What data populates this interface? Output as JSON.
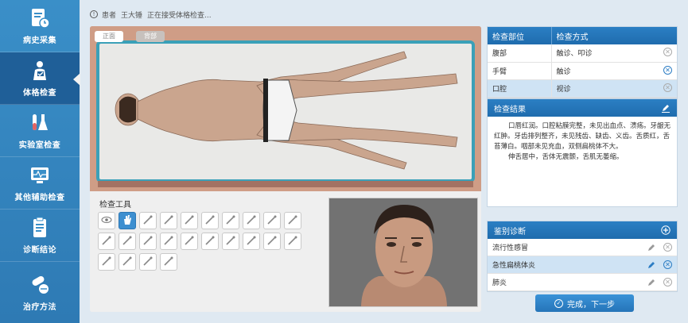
{
  "sidebar": {
    "items": [
      {
        "label": "病史采集",
        "icon": "clock-clipboard-icon"
      },
      {
        "label": "体格检查",
        "icon": "person-check-icon"
      },
      {
        "label": "实验室检查",
        "icon": "test-tube-icon"
      },
      {
        "label": "其他辅助检查",
        "icon": "monitor-icon"
      },
      {
        "label": "诊断结论",
        "icon": "clipboard-icon"
      },
      {
        "label": "治疗方法",
        "icon": "pills-icon"
      }
    ]
  },
  "status": {
    "patient_label": "患者",
    "patient_name": "王大锤",
    "status_text": "正在接受体格检查..."
  },
  "viewer": {
    "front_label": "正面",
    "back_label": "背部"
  },
  "tools": {
    "title": "检查工具",
    "items": [
      "eye-icon",
      "hand-icon",
      "reflex-hammer-icon",
      "pen-light-icon",
      "stethoscope-icon",
      "tape-measure-icon",
      "tongue-depressor-icon",
      "flashlight-icon",
      "pin-icon",
      "ruler-icon",
      "needle-icon",
      "cotton-swab-icon",
      "thermometer-icon",
      "otoscope-icon",
      "hammer-icon",
      "tweezers-icon",
      "tuning-fork-icon",
      "probe-icon",
      "chart-icon",
      "gauze-icon",
      "tape-roll-icon",
      "glove-icon",
      "dropper-icon",
      "bp-cuff-icon"
    ],
    "active_index": 1
  },
  "exam_table": {
    "headers": [
      "检查部位",
      "检查方式"
    ],
    "rows": [
      {
        "part": "腹部",
        "method": "触诊、叩诊"
      },
      {
        "part": "手臂",
        "method": "触诊"
      },
      {
        "part": "口腔",
        "method": "视诊"
      }
    ],
    "selected_index": 2
  },
  "result": {
    "title": "检查结果",
    "paragraphs": [
      "口唇红润。口腔粘膜完整，未见出血点、溃疡。牙龈无红肿。牙齿排列整齐，未见残齿、缺齿、义齿。舌质红，舌苔薄白。咽部未见充血，双侧扁桃体不大。",
      "伸舌居中，舌体无震颤，舌肌无萎缩。"
    ]
  },
  "diagnosis": {
    "title": "鉴别诊断",
    "items": [
      "流行性感冒",
      "急性扁桃体炎",
      "肺炎"
    ],
    "selected_index": 1
  },
  "next_button": {
    "label": "完成，下一步"
  },
  "colors": {
    "accent": "#2b7fc4",
    "sidebar": "#3a8fc8",
    "sidebar_active": "#1f5f98",
    "selected_row": "#cfe3f4"
  }
}
